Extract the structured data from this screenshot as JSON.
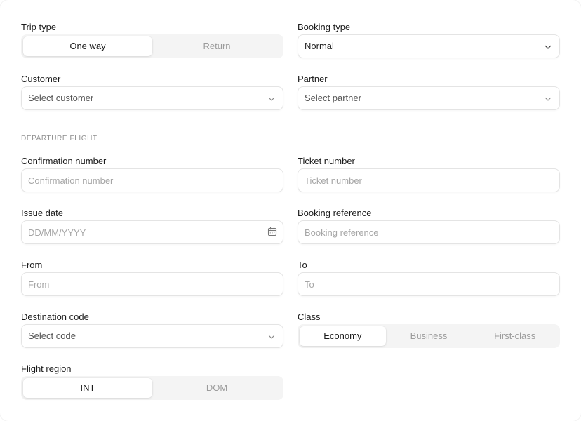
{
  "trip_type": {
    "label": "Trip type",
    "options": [
      "One way",
      "Return"
    ],
    "selected": "One way"
  },
  "booking_type": {
    "label": "Booking type",
    "value": "Normal"
  },
  "customer": {
    "label": "Customer",
    "value": "Select customer"
  },
  "partner": {
    "label": "Partner",
    "value": "Select partner"
  },
  "section_title": "DEPARTURE FLIGHT",
  "confirmation": {
    "label": "Confirmation number",
    "placeholder": "Confirmation number"
  },
  "ticket": {
    "label": "Ticket number",
    "placeholder": "Ticket number"
  },
  "issue_date": {
    "label": "Issue date",
    "placeholder": "DD/MM/YYYY"
  },
  "booking_ref": {
    "label": "Booking reference",
    "placeholder": "Booking reference"
  },
  "from": {
    "label": "From",
    "placeholder": "From"
  },
  "to": {
    "label": "To",
    "placeholder": "To"
  },
  "destination_code": {
    "label": "Destination code",
    "value": "Select code"
  },
  "class": {
    "label": "Class",
    "options": [
      "Economy",
      "Business",
      "First-class"
    ],
    "selected": "Economy"
  },
  "flight_region": {
    "label": "Flight region",
    "options": [
      "INT",
      "DOM"
    ],
    "selected": "INT"
  },
  "icons": {
    "dropdown": "chevron-down-icon",
    "date": "calendar-icon"
  }
}
